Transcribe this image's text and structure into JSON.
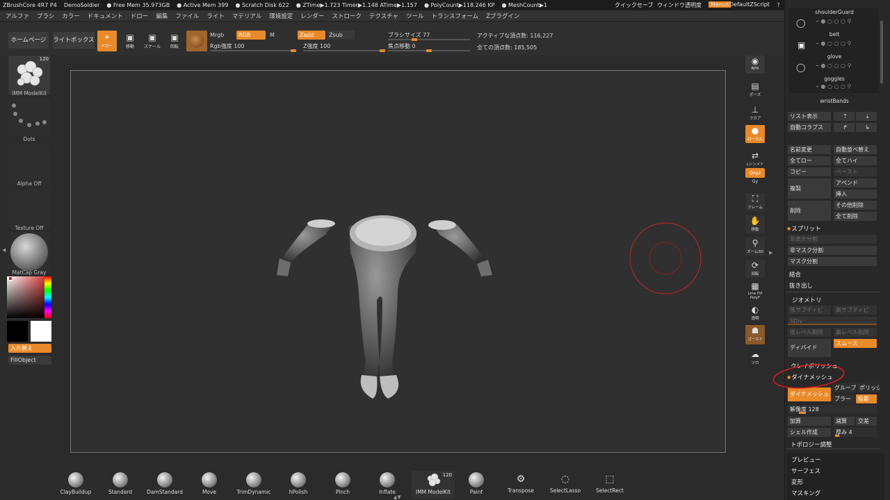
{
  "titlebar": {
    "items": [
      "ZBrushCore 4R7 P4",
      "DemoSoldier",
      "● Free Mem 35.973GB",
      "● Active Mem 399",
      "● Scratch Disk 622",
      "● ZTime▶1.723 Timer▶1.148 ATime▶1.157",
      "● PolyCount▶118.246 KP",
      "● MeshCount▶1"
    ],
    "quicksave": "クイックセーブ",
    "transparency": "ウィンドウ透明度",
    "menus": "Menus",
    "script": "DefaultZScript"
  },
  "menubar": [
    "アルファ",
    "ブラシ",
    "カラー",
    "ドキュメント",
    "ドロー",
    "編集",
    "ファイル",
    "ライト",
    "マテリアル",
    "環境設定",
    "レンダー",
    "ストローク",
    "テクスチャ",
    "ツール",
    "トランスフォーム",
    "Zプラグイン"
  ],
  "toolbar": {
    "home": "ホームページ",
    "lightbox": "ライトボックス",
    "draw": "ドロー",
    "move": "移動",
    "scale": "スケール",
    "rotate": "回転",
    "mrgb": "Mrgb",
    "rgb": "RGB",
    "m": "M",
    "rgb_intensity": "Rgb強度 100",
    "zadd": "Zadd",
    "zsub": "Zsub",
    "z_intensity": "Z強度 100",
    "brush_size": "ブラシサイズ 77",
    "focal_shift": "焦点移動 0",
    "active_points": "アクティブな頂点数: 116,227",
    "total_points": "全ての頂点数: 185,505",
    "levels": {
      "rgb_intensity": 100,
      "z_intensity": 100,
      "brush_size": 77,
      "focal_shift": 0
    }
  },
  "leftshelf": {
    "tool_label": "IMM ModelKit",
    "tool_count": "120",
    "dots": "Dots",
    "alpha": "Alpha Off",
    "texture": "Texture Off",
    "material": "MatCap Gray",
    "swap": "入れ替え",
    "fill": "FillObject"
  },
  "rightshelf": [
    "BPR",
    "ポーズ",
    "フロア",
    "ローカル",
    "Lシンメトリ",
    "Qxyz",
    "Gy",
    "フレーム",
    "移動",
    "ズーム3D",
    "回転",
    "Line Fill PolyF",
    "透明",
    "ゴースト",
    "ソロ"
  ],
  "panel": {
    "subtools": [
      "shoulderGuard",
      "belt",
      "glove",
      "goggles",
      "wristBands"
    ],
    "list_display": "リスト表示",
    "auto_collapse": "自動コラプス",
    "rename": "名前変更",
    "auto_reorder": "自動並べ替え",
    "all_low": "全てロー",
    "all_high": "全てハイ",
    "copy": "コピー",
    "paste": "ペースト",
    "append": "アペンド",
    "duplicate": "複製",
    "insert": "挿入",
    "delete": "削除",
    "delete_other": "その他削除",
    "delete_all": "全て削除",
    "split": "スプリット",
    "split_hidden": "非表示分割",
    "split_unmasked": "非マスク分割",
    "split_mask": "マスク分割",
    "merge": "結合",
    "extract": "抜き出し",
    "geometry": "ジオメトリ",
    "lower_subdiv": "低サブディビ",
    "higher_subdiv": "高サブディビ",
    "sdiv": "SDiv",
    "del_lower": "低レベル削除",
    "del_higher": "高レベル削除",
    "divide": "ディバイド",
    "smooth": "スムース",
    "clay_polish": "クレイポリッシュ",
    "dynamesh_section": "ダイナメッシュ",
    "dynamesh_btn": "ダイナメッシュ",
    "groups": "グループ",
    "polish": "ポリッシュ",
    "blur": "ブラー",
    "project": "投影",
    "resolution": "解像度 128",
    "add": "加算",
    "subtract": "減算",
    "intersect": "交差",
    "shell": "シェル作成",
    "thickness": "厚み 4",
    "topology": "トポロジー調整"
  },
  "bottom": {
    "brushes": [
      {
        "name": "ClayBuildup",
        "icon": "clay-ball"
      },
      {
        "name": "Standard",
        "icon": "standard-ball"
      },
      {
        "name": "DamStandard",
        "icon": "damstandard-ball"
      },
      {
        "name": "Move",
        "icon": "move-ball"
      },
      {
        "name": "TrimDynamic",
        "icon": "trimdynamic-ball"
      },
      {
        "name": "hPolish",
        "icon": "hpolish-ball"
      },
      {
        "name": "Pinch",
        "icon": "pinch-ball"
      },
      {
        "name": "Inflate",
        "icon": "inflate-ball"
      },
      {
        "name": "IMM ModelKit",
        "icon": "imm-modelkit"
      },
      {
        "name": "Paint",
        "icon": "paint-ball"
      },
      {
        "name": "Transpose",
        "icon": "transpose-icon"
      },
      {
        "name": "SelectLasso",
        "icon": "selectlasso-icon"
      },
      {
        "name": "SelectRect",
        "icon": "selectrect-icon"
      }
    ],
    "imm_count": "120",
    "menu": [
      "プレビュー",
      "サーフェス",
      "変形",
      "マスキング"
    ]
  },
  "colors": {
    "accent": "#e98a2a",
    "annotation": "#d41e1e"
  }
}
